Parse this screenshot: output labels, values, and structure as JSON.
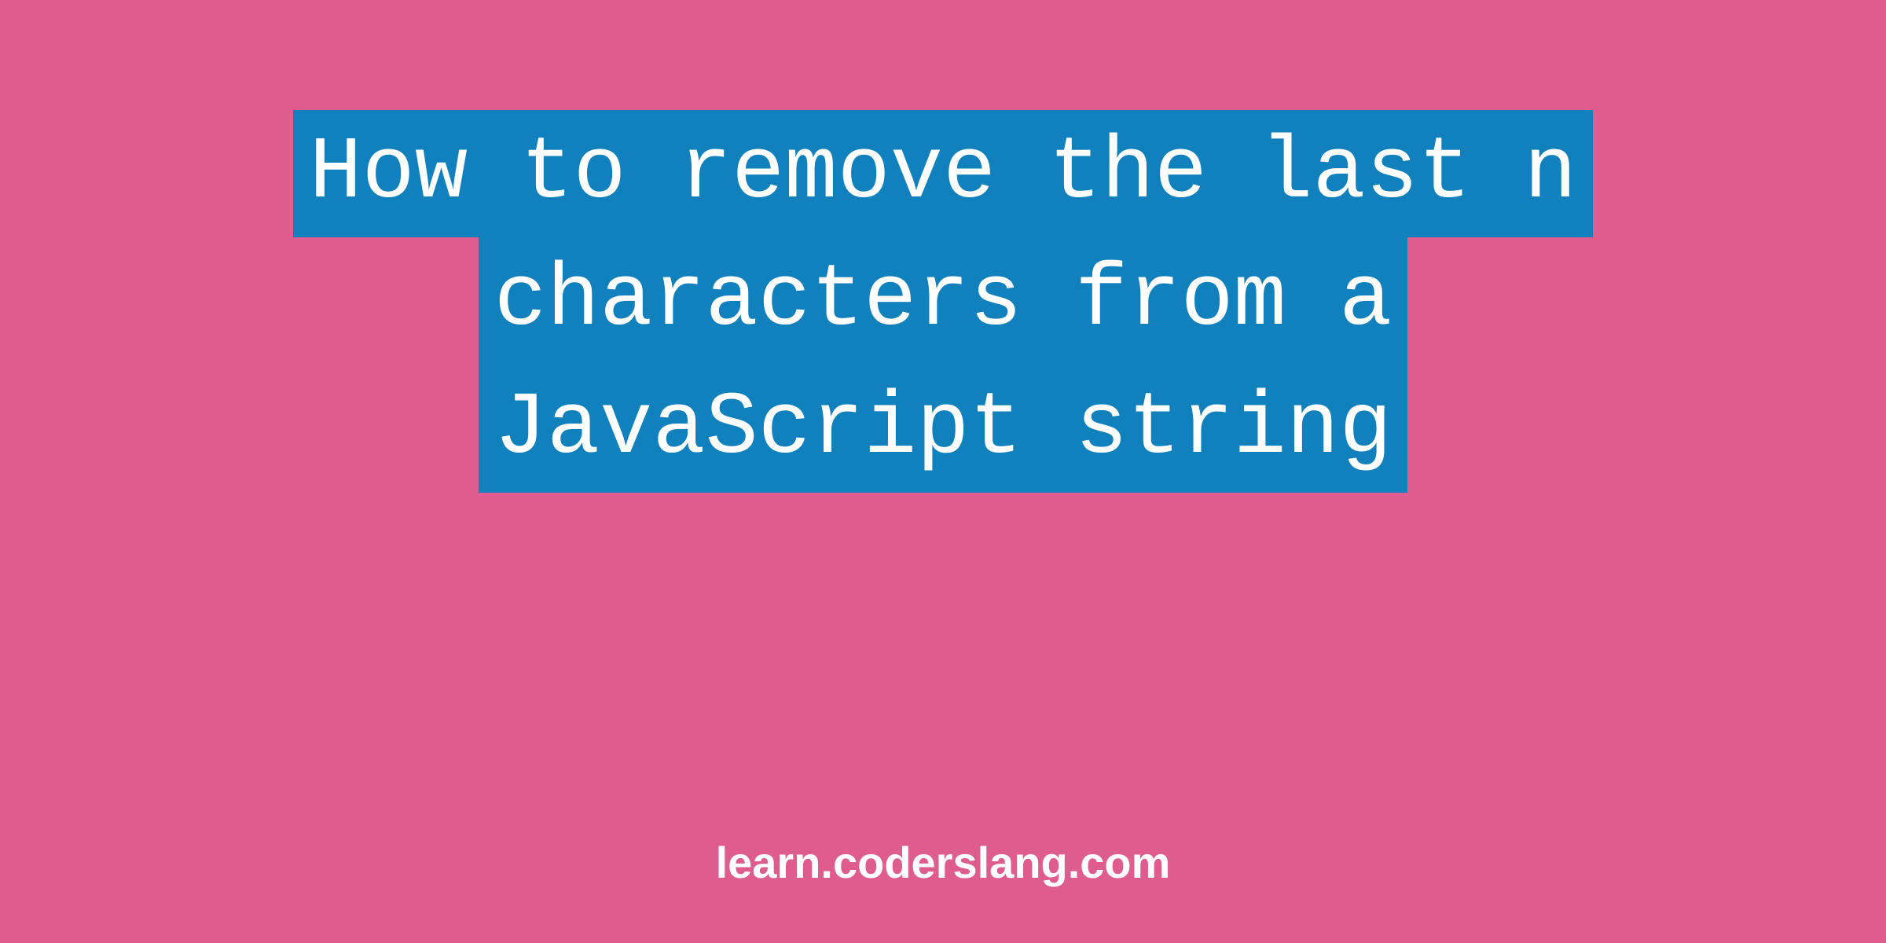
{
  "heading": {
    "line1": "How to remove the last n",
    "line2": "characters from a",
    "line3": "JavaScript string"
  },
  "footer": {
    "url": "learn.coderslang.com"
  },
  "colors": {
    "background": "#de5c8e",
    "highlight": "#1081bc",
    "text": "#ffffff"
  }
}
